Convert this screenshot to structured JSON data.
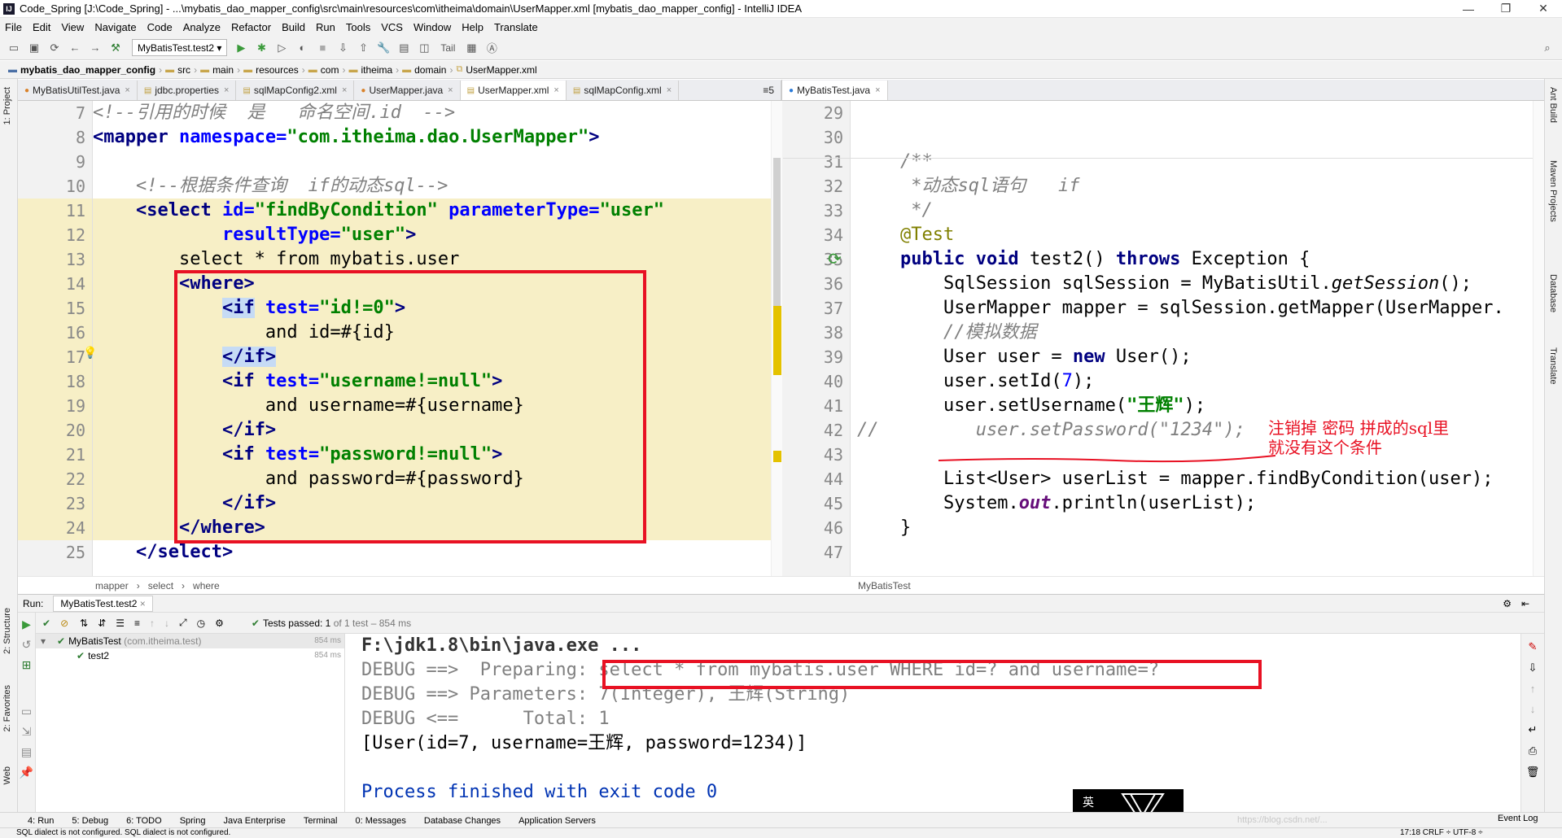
{
  "window": {
    "title": "Code_Spring [J:\\Code_Spring] - ...\\mybatis_dao_mapper_config\\src\\main\\resources\\com\\itheima\\domain\\UserMapper.xml [mybatis_dao_mapper_config] - IntelliJ IDEA",
    "icon_label": "IJ",
    "controls": [
      "—",
      "❐",
      "✕"
    ]
  },
  "menu": [
    "File",
    "Edit",
    "View",
    "Navigate",
    "Code",
    "Analyze",
    "Refactor",
    "Build",
    "Run",
    "Tools",
    "VCS",
    "Window",
    "Help",
    "Translate"
  ],
  "toolbar": {
    "run_config": "MyBatisTest.test2",
    "tail_label": "Tail"
  },
  "breadcrumbs": [
    "mybatis_dao_mapper_config",
    "src",
    "main",
    "resources",
    "com",
    "itheima",
    "domain",
    "UserMapper.xml"
  ],
  "left_tabs": [
    "MyBatisUtilTest.java",
    "jdbc.properties",
    "sqlMapConfig2.xml",
    "UserMapper.java",
    "UserMapper.xml",
    "sqlMapConfig.xml"
  ],
  "left_tab_overflow": "≡5",
  "right_tabs": [
    "MyBatisTest.java"
  ],
  "side_left": [
    "1: Project",
    "2: Structure",
    "2: Favorites",
    "Web"
  ],
  "side_right": [
    "Ant Build",
    "Maven Projects",
    "Database",
    "Translate"
  ],
  "xml_editor": {
    "line_numbers": [
      "7",
      "8",
      "9",
      "10",
      "11",
      "12",
      "13",
      "14",
      "15",
      "16",
      "17",
      "18",
      "19",
      "20",
      "21",
      "22",
      "23",
      "24",
      "25"
    ],
    "lines": [
      {
        "indent": "",
        "parts": [
          {
            "t": "<!--引用的时候  是   命名空间.id  -->",
            "c": "cmt"
          }
        ]
      },
      {
        "indent": "",
        "parts": [
          {
            "t": "<mapper ",
            "c": "tag"
          },
          {
            "t": "namespace=",
            "c": "attr"
          },
          {
            "t": "\"com.itheima.dao.UserMapper\"",
            "c": "val"
          },
          {
            "t": ">",
            "c": "tag"
          }
        ]
      },
      {
        "indent": "",
        "parts": []
      },
      {
        "indent": "    ",
        "parts": [
          {
            "t": "<!--根据条件查询  if的动态sql-->",
            "c": "cmt"
          }
        ]
      },
      {
        "indent": "    ",
        "parts": [
          {
            "t": "<select ",
            "c": "tag"
          },
          {
            "t": "id=",
            "c": "attr"
          },
          {
            "t": "\"findByCondition\" ",
            "c": "val"
          },
          {
            "t": "parameterType=",
            "c": "attr"
          },
          {
            "t": "\"user\"",
            "c": "val"
          }
        ]
      },
      {
        "indent": "            ",
        "parts": [
          {
            "t": "resultType=",
            "c": "attr"
          },
          {
            "t": "\"user\"",
            "c": "val"
          },
          {
            "t": ">",
            "c": "tag"
          }
        ]
      },
      {
        "indent": "        ",
        "parts": [
          {
            "t": "select * from mybatis.user",
            "c": "plain"
          }
        ]
      },
      {
        "indent": "        ",
        "parts": [
          {
            "t": "<where>",
            "c": "tag"
          }
        ]
      },
      {
        "indent": "            ",
        "parts": [
          {
            "t": "<if",
            "c": "tag sel"
          },
          {
            "t": " test=",
            "c": "attr"
          },
          {
            "t": "\"id!=0\"",
            "c": "val"
          },
          {
            "t": ">",
            "c": "tag"
          }
        ]
      },
      {
        "indent": "                ",
        "parts": [
          {
            "t": "and id=#{id}",
            "c": "plain"
          }
        ]
      },
      {
        "indent": "            ",
        "parts": [
          {
            "t": "</if>",
            "c": "tag sel"
          }
        ]
      },
      {
        "indent": "            ",
        "parts": [
          {
            "t": "<if ",
            "c": "tag"
          },
          {
            "t": "test=",
            "c": "attr"
          },
          {
            "t": "\"username!=null\"",
            "c": "val"
          },
          {
            "t": ">",
            "c": "tag"
          }
        ]
      },
      {
        "indent": "                ",
        "parts": [
          {
            "t": "and username=#{username}",
            "c": "plain"
          }
        ]
      },
      {
        "indent": "            ",
        "parts": [
          {
            "t": "</if>",
            "c": "tag"
          }
        ]
      },
      {
        "indent": "            ",
        "parts": [
          {
            "t": "<if ",
            "c": "tag"
          },
          {
            "t": "test=",
            "c": "attr"
          },
          {
            "t": "\"password!=null\"",
            "c": "val"
          },
          {
            "t": ">",
            "c": "tag"
          }
        ]
      },
      {
        "indent": "                ",
        "parts": [
          {
            "t": "and password=#{password}",
            "c": "plain"
          }
        ]
      },
      {
        "indent": "            ",
        "parts": [
          {
            "t": "</if>",
            "c": "tag"
          }
        ]
      },
      {
        "indent": "        ",
        "parts": [
          {
            "t": "</where>",
            "c": "tag"
          }
        ]
      },
      {
        "indent": "    ",
        "parts": [
          {
            "t": "</select>",
            "c": "tag"
          }
        ]
      }
    ],
    "breadcrumb": [
      "mapper",
      "select",
      "where"
    ]
  },
  "java_editor": {
    "line_numbers": [
      "29",
      "30",
      "31",
      "32",
      "33",
      "34",
      "35",
      "36",
      "37",
      "38",
      "39",
      "40",
      "41",
      "42",
      "43",
      "44",
      "45",
      "46",
      "47"
    ],
    "lines": [
      {
        "indent": "",
        "parts": []
      },
      {
        "indent": "",
        "parts": []
      },
      {
        "indent": "    ",
        "parts": [
          {
            "t": "/**",
            "c": "cmt"
          }
        ]
      },
      {
        "indent": "     ",
        "parts": [
          {
            "t": "*动态sql语句   if",
            "c": "cmt"
          }
        ]
      },
      {
        "indent": "     ",
        "parts": [
          {
            "t": "*/",
            "c": "cmt"
          }
        ]
      },
      {
        "indent": "    ",
        "parts": [
          {
            "t": "@Test",
            "c": "ann"
          }
        ]
      },
      {
        "indent": "    ",
        "parts": [
          {
            "t": "public void ",
            "c": "kw"
          },
          {
            "t": "test2() ",
            "c": "plain"
          },
          {
            "t": "throws ",
            "c": "kw"
          },
          {
            "t": "Exception {",
            "c": "plain"
          }
        ]
      },
      {
        "indent": "        ",
        "parts": [
          {
            "t": "SqlSession sqlSession = MyBatisUtil.",
            "c": "plain"
          },
          {
            "t": "getSession",
            "c": "meth"
          },
          {
            "t": "();",
            "c": "plain"
          }
        ]
      },
      {
        "indent": "        ",
        "parts": [
          {
            "t": "UserMapper mapper = sqlSession.getMapper(UserMapper.",
            "c": "plain"
          }
        ]
      },
      {
        "indent": "        ",
        "parts": [
          {
            "t": "//模拟数据",
            "c": "cmt"
          }
        ]
      },
      {
        "indent": "        ",
        "parts": [
          {
            "t": "User user = ",
            "c": "plain"
          },
          {
            "t": "new ",
            "c": "kw"
          },
          {
            "t": "User();",
            "c": "plain"
          }
        ]
      },
      {
        "indent": "        ",
        "parts": [
          {
            "t": "user.setId(",
            "c": "plain"
          },
          {
            "t": "7",
            "c": "num"
          },
          {
            "t": ");",
            "c": "plain"
          }
        ]
      },
      {
        "indent": "        ",
        "parts": [
          {
            "t": "user.setUsername(",
            "c": "plain"
          },
          {
            "t": "\"王辉\"",
            "c": "str"
          },
          {
            "t": ");",
            "c": "plain"
          }
        ]
      },
      {
        "indent": "",
        "parts": [
          {
            "t": "//         user.setPassword(\"1234\");",
            "c": "cmt"
          }
        ]
      },
      {
        "indent": "",
        "parts": []
      },
      {
        "indent": "        ",
        "parts": [
          {
            "t": "List<User> userList = mapper.findByCondition(user);",
            "c": "plain"
          }
        ]
      },
      {
        "indent": "        ",
        "parts": [
          {
            "t": "System.",
            "c": "plain"
          },
          {
            "t": "out",
            "c": "static"
          },
          {
            "t": ".println(userList);",
            "c": "plain"
          }
        ]
      },
      {
        "indent": "    ",
        "parts": [
          {
            "t": "}",
            "c": "plain"
          }
        ]
      },
      {
        "indent": "",
        "parts": []
      }
    ],
    "breadcrumb": "MyBatisTest"
  },
  "annotation": {
    "line1": "注销掉  密码   拼成的sql里",
    "line2": "就没有这个条件"
  },
  "run": {
    "label": "Run:",
    "tab": "MyBatisTest.test2",
    "status": "Tests passed: ",
    "status_count": "1",
    "status_detail": " of 1 test – 854 ms",
    "tree": [
      {
        "name": "MyBatisTest",
        "pkg": " (com.itheima.test)",
        "time": "854 ms"
      },
      {
        "name": "test2",
        "pkg": "",
        "time": "854 ms"
      }
    ],
    "console": [
      {
        "t": "F:\\jdk1.8\\bin\\java.exe ...",
        "c": "bold"
      },
      {
        "t": "DEBUG ==>  Preparing: select * from mybatis.user WHERE id=? and username=?",
        "c": "gray"
      },
      {
        "t": "DEBUG ==> Parameters: 7(Integer), 王辉(String)",
        "c": "gray"
      },
      {
        "t": "DEBUG <==      Total: 1",
        "c": "gray"
      },
      {
        "t": "[User(id=7, username=王辉, password=1234)]",
        "c": "plain"
      },
      {
        "t": "",
        "c": "plain"
      },
      {
        "t": "Process finished with exit code 0",
        "c": "blue"
      }
    ]
  },
  "bottom_tabs": [
    "4: Run",
    "5: Debug",
    "6: TODO",
    "Spring",
    "Java Enterprise",
    "Terminal",
    "0: Messages",
    "Database Changes",
    "Application Servers"
  ],
  "event_log": "Event Log",
  "status_text": "SQL dialect is not configured. SQL dialect is not configured.",
  "status_right": "17:18   CRLF ÷   UTF-8 ÷",
  "ime": "英",
  "watermark": "https://blog.csdn.net/..."
}
